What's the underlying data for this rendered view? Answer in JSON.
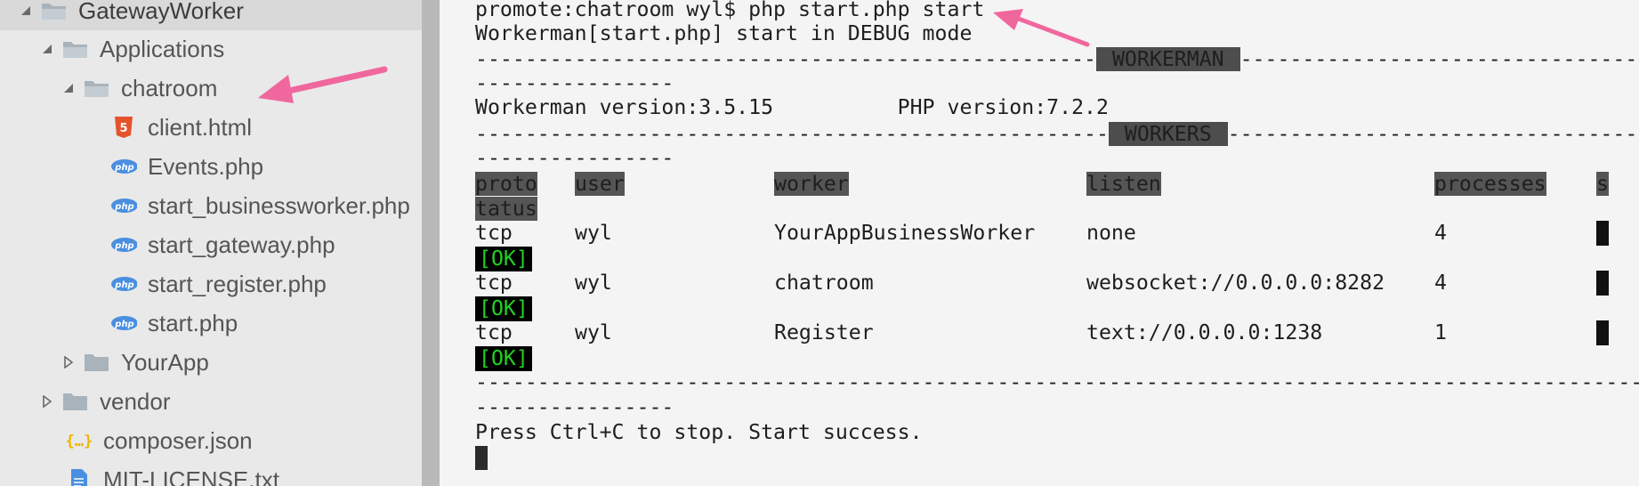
{
  "sidebar": {
    "items": [
      {
        "label": "GatewayWorker",
        "icon": "folder-open-icon",
        "expanded": true
      },
      {
        "label": "Applications",
        "icon": "folder-open-icon",
        "expanded": true
      },
      {
        "label": "chatroom",
        "icon": "folder-open-icon",
        "expanded": true
      },
      {
        "label": "client.html",
        "icon": "html5-icon"
      },
      {
        "label": "Events.php",
        "icon": "php-icon"
      },
      {
        "label": "start_businessworker.php",
        "icon": "php-icon"
      },
      {
        "label": "start_gateway.php",
        "icon": "php-icon"
      },
      {
        "label": "start_register.php",
        "icon": "php-icon"
      },
      {
        "label": "start.php",
        "icon": "php-icon"
      },
      {
        "label": "YourApp",
        "icon": "folder-icon",
        "expanded": false
      },
      {
        "label": "vendor",
        "icon": "folder-icon",
        "expanded": false
      },
      {
        "label": "composer.json",
        "icon": "json-icon"
      },
      {
        "label": "MIT-LICENSE.txt",
        "icon": "text-file-icon"
      }
    ],
    "php_badge": "php"
  },
  "terminal": {
    "prompt_line": "promote:chatroom wyl$ php start.php start",
    "mode_line": "Workerman[start.php] start in DEBUG mode",
    "banner1": " WORKERMAN ",
    "versions": "Workerman version:3.5.15          PHP version:7.2.2",
    "banner2": " WORKERS ",
    "headers": {
      "proto": "proto",
      "proto_cont": "tatus",
      "user": "user",
      "worker": "worker",
      "listen": "listen",
      "processes": "processes",
      "status": "s"
    },
    "rows": [
      {
        "proto": "tcp",
        "user": "wyl",
        "worker": "YourAppBusinessWorker",
        "listen": "none",
        "processes": "4",
        "status": "[OK]"
      },
      {
        "proto": "tcp",
        "user": "wyl",
        "worker": "chatroom",
        "listen": "websocket://0.0.0.0:8282",
        "processes": "4",
        "status": "[OK]"
      },
      {
        "proto": "tcp",
        "user": "wyl",
        "worker": "Register",
        "listen": "text://0.0.0.0:1238",
        "processes": "1",
        "status": "[OK]"
      }
    ],
    "final_line": "Press Ctrl+C to stop. Start success."
  },
  "colors": {
    "arrow": "#f0679e",
    "ok_text": "#21d321",
    "banner_bg": "#4d4d4d"
  }
}
